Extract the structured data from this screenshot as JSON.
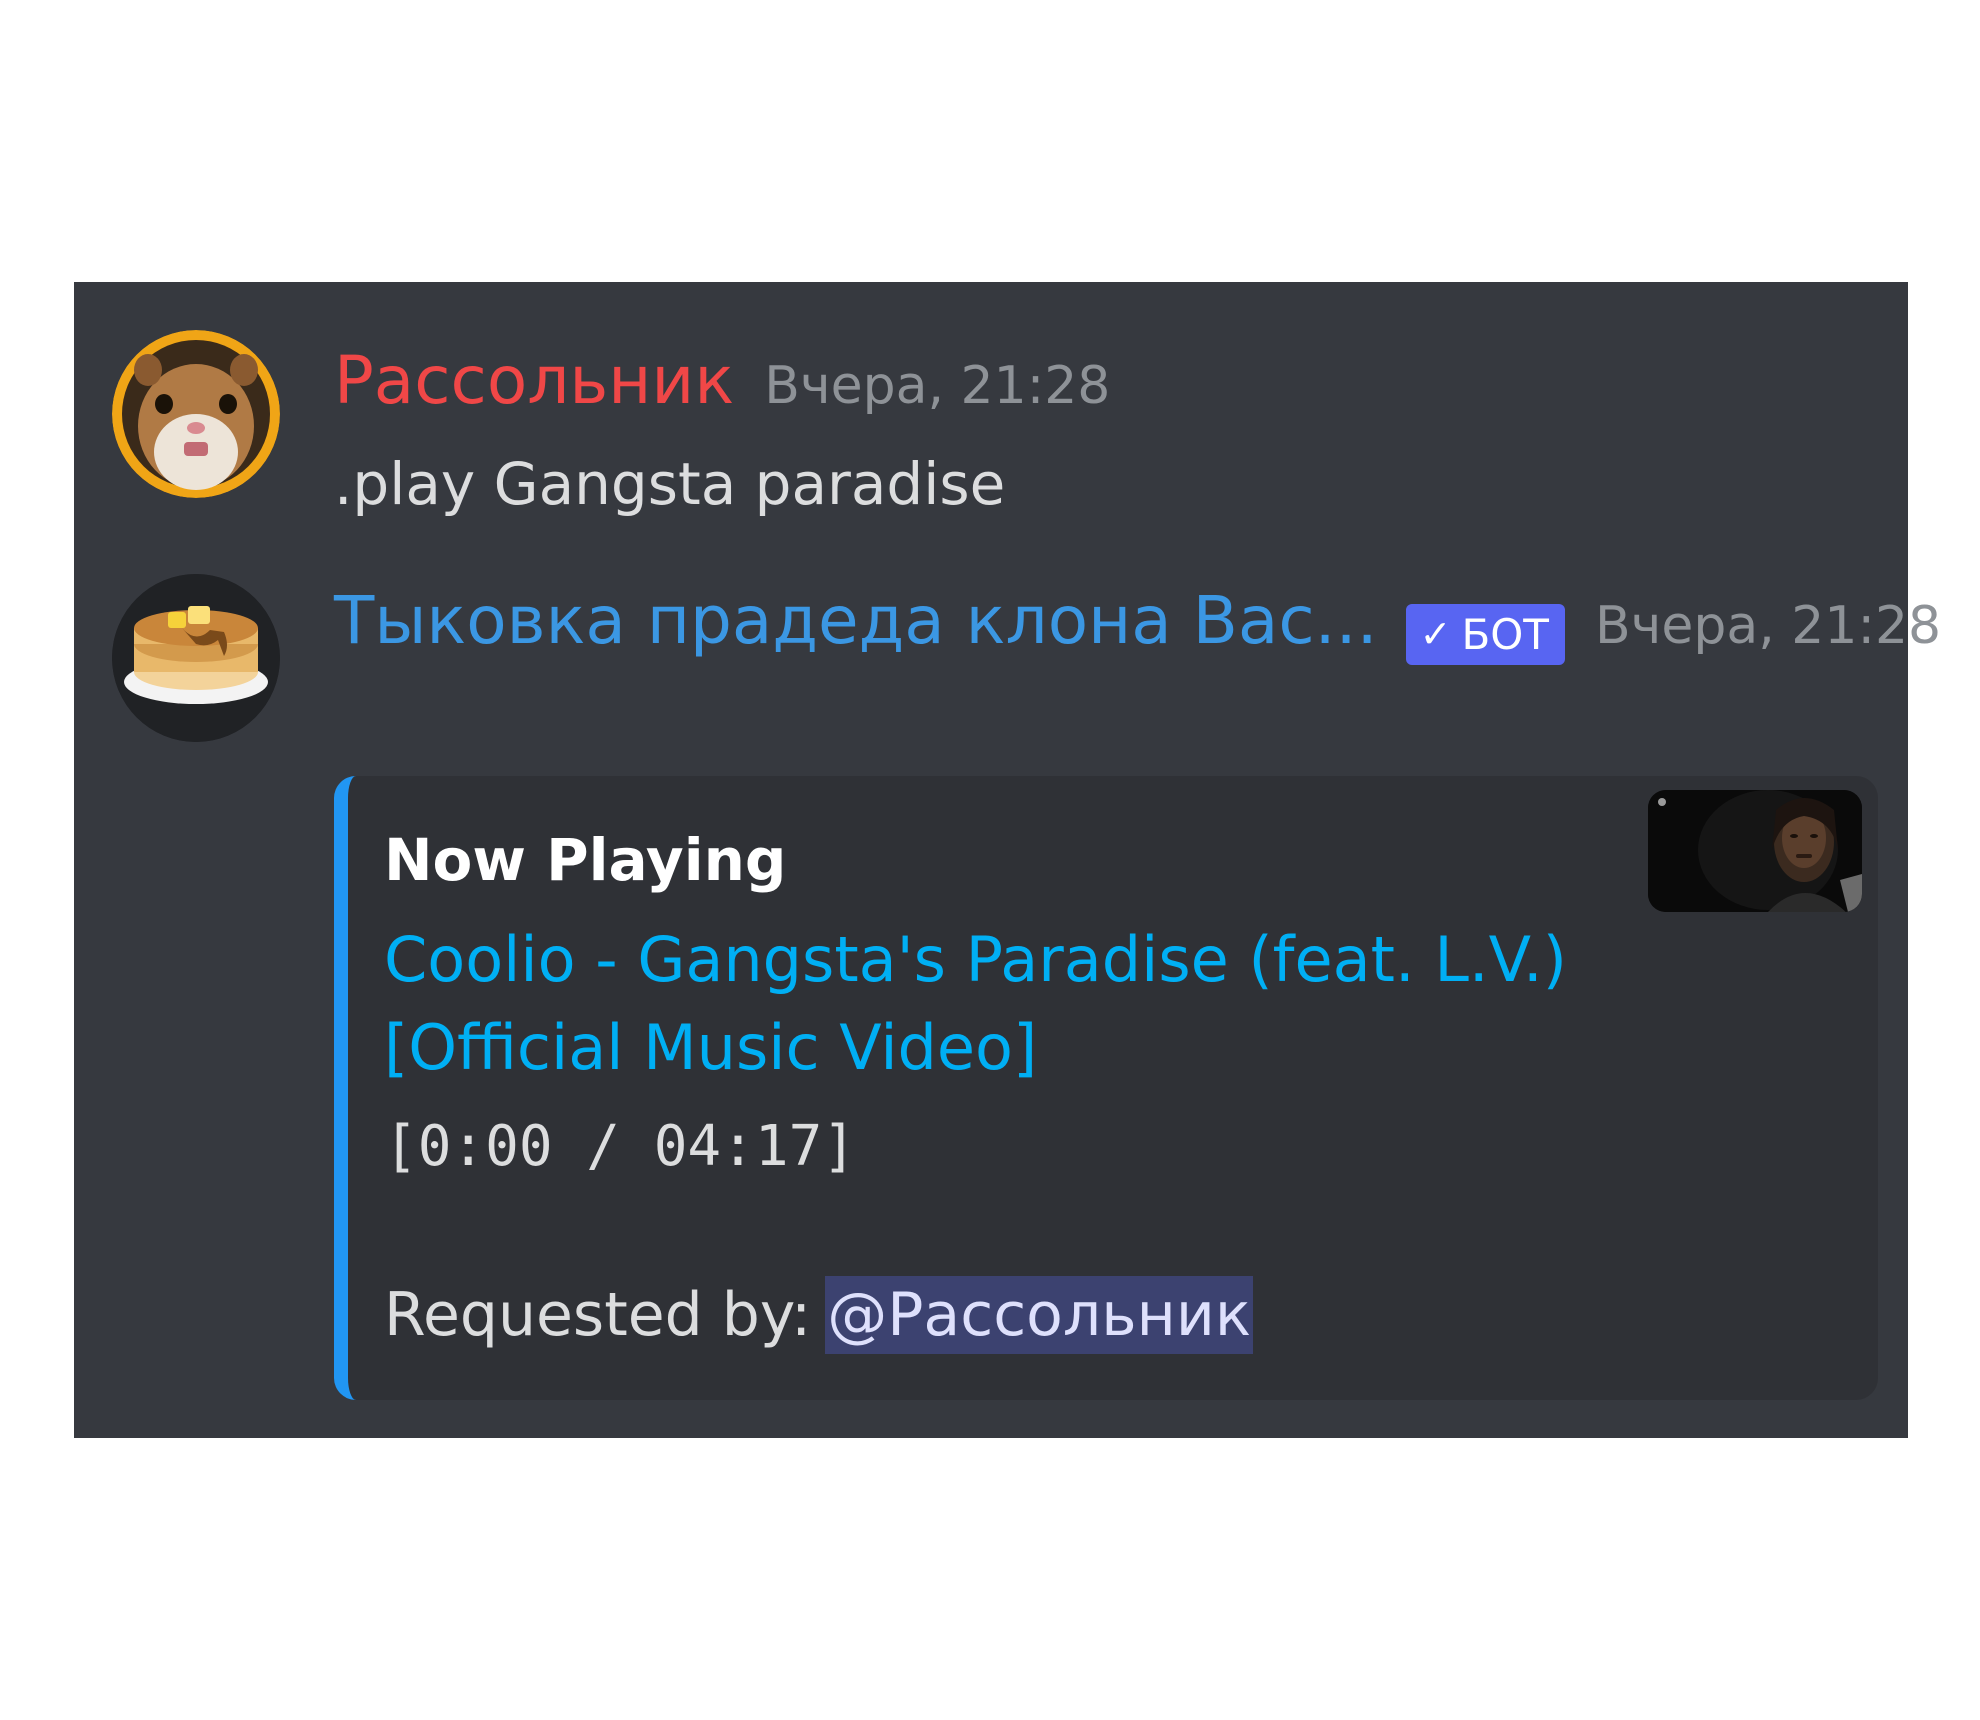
{
  "messages": [
    {
      "username": "Рассольник",
      "username_color": "#f04747",
      "timestamp": "Вчера, 21:28",
      "text": ".play Gangsta paradise",
      "avatar_icon": "hamster-avatar"
    },
    {
      "username": "Тыковка прадеда клона Вас...",
      "username_color": "#3b97e3",
      "bot_tag": {
        "check": "✓",
        "label": "БОТ"
      },
      "timestamp": "Вчера, 21:28",
      "avatar_icon": "pancakes-avatar"
    }
  ],
  "embed": {
    "accent_color": "#2196f3",
    "title": "Now Playing",
    "link_line1": "Coolio - Gangsta's Paradise (feat. L.V.)",
    "link_line2": "[Official Music Video]",
    "time": "[0:00 / 04:17]",
    "requested_label": "Requested by:",
    "requested_mention": "@Рассольник",
    "thumbnail_icon": "music-video-thumbnail"
  }
}
